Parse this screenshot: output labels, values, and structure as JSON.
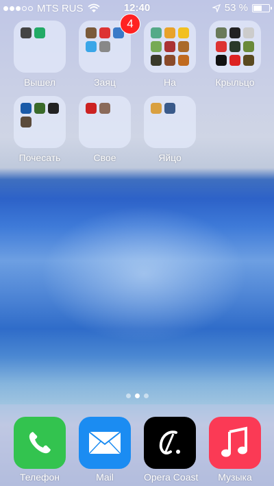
{
  "status_bar": {
    "carrier": "MTS RUS",
    "time": "12:40",
    "battery_percent": "53 %",
    "battery_level": 0.53,
    "signal_bars_filled": 3,
    "signal_bars_total": 5
  },
  "folders": [
    {
      "label": "Вышел",
      "apps": [
        "#444",
        "#2a6"
      ],
      "badge": ""
    },
    {
      "label": "Заяц",
      "apps": [
        "#7a5a3a",
        "#d33",
        "#3a7ac8",
        "#3aa6e8",
        "#888"
      ],
      "badge": "4"
    },
    {
      "label": "На",
      "apps": [
        "#5a8",
        "#e8a22a",
        "#f2c020",
        "#7a5",
        "#a33",
        "#aa6a2a",
        "#3a3a2a",
        "#8a4a2a",
        "#c06a20"
      ],
      "badge": ""
    },
    {
      "label": "Крыльцо",
      "apps": [
        "#6a7a5a",
        "#222",
        "#ccc",
        "#d33",
        "#2a3a2a",
        "#6a8a3a",
        "#111",
        "#d22",
        "#5a4a20"
      ],
      "badge": ""
    },
    {
      "label": "Почесать",
      "apps": [
        "#1a5aa8",
        "#3a6a2a",
        "#222",
        "#5a4a3a"
      ],
      "badge": ""
    },
    {
      "label": "Свое",
      "apps": [
        "#c22",
        "#8a6a5a"
      ],
      "badge": ""
    },
    {
      "label": "Яйцо",
      "apps": [
        "#d9a040",
        "#3a5a8a"
      ],
      "badge": ""
    }
  ],
  "page_indicator": {
    "count": 3,
    "active": 1
  },
  "dock": [
    {
      "label": "Телефон",
      "icon": "phone-icon",
      "color": "#33c34f"
    },
    {
      "label": "Mail",
      "icon": "mail-icon",
      "color": "#1b8cf2"
    },
    {
      "label": "Opera Coast",
      "icon": "opera-coast-icon",
      "color": "#000000"
    },
    {
      "label": "Музыка",
      "icon": "music-icon",
      "color": "#fb3a55"
    }
  ]
}
